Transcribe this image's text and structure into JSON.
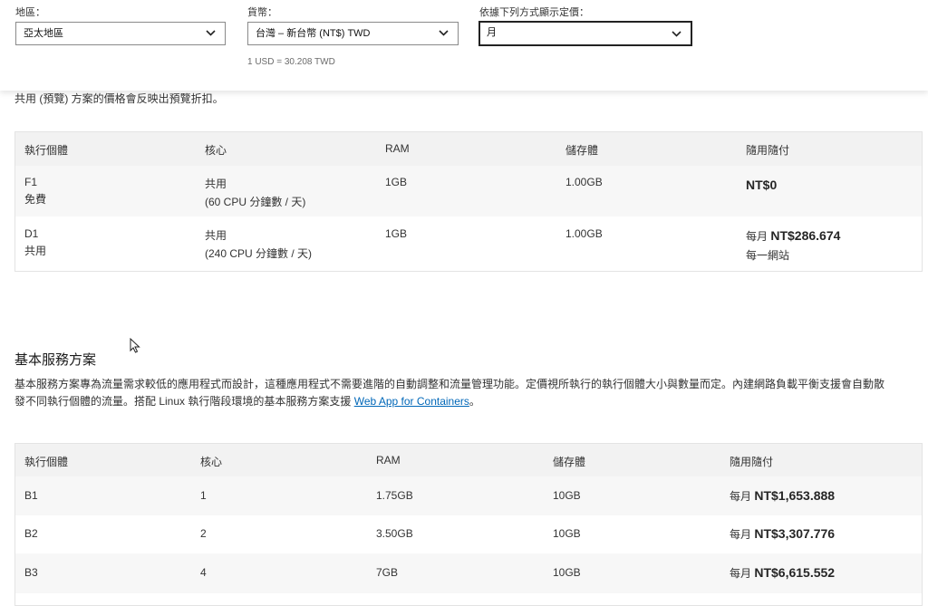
{
  "filters": {
    "region": {
      "label": "地區：",
      "value": "亞太地區"
    },
    "currency": {
      "label": "貨幣：",
      "value": "台灣 – 新台幣 (NT$) TWD"
    },
    "display": {
      "label": "依據下列方式顯示定價：",
      "value": "月"
    },
    "rate_note": "1 USD = 30.208 TWD"
  },
  "preview_note": "共用 (預覽) 方案的價格會反映出預覽折扣。",
  "free_shared_table": {
    "headers": [
      "執行個體",
      "核心",
      "RAM",
      "儲存體",
      "隨用隨付"
    ],
    "rows": [
      {
        "instance": "F1",
        "instance_sub": "免費",
        "cores": "共用",
        "cores_sub": "(60 CPU 分鐘數 / 天)",
        "ram": "1GB",
        "storage": "1.00GB",
        "price_prefix": "",
        "price": "NT$0",
        "price_sub": ""
      },
      {
        "instance": "D1",
        "instance_sub": "共用",
        "cores": "共用",
        "cores_sub": "(240 CPU 分鐘數 / 天)",
        "ram": "1GB",
        "storage": "1.00GB",
        "price_prefix": "每月",
        "price": "NT$286.674",
        "price_sub": "每一網站"
      }
    ]
  },
  "basic_section": {
    "title": "基本服務方案",
    "description_line1": "基本服務方案專為流量需求較低的應用程式而設計，這種應用程式不需要進階的自動調整和流量管理功能。定價視所執行的執行個體大小與數量而定。內建網路負載平衡支援會自動散",
    "description_line2_before": "發不同執行個體的流量。搭配 Linux 執行階段環境的基本服務方案支援 ",
    "link_text": "Web App for Containers",
    "description_line2_after": "。"
  },
  "basic_table": {
    "headers": [
      "執行個體",
      "核心",
      "RAM",
      "儲存體",
      "隨用隨付"
    ],
    "rows": [
      {
        "instance": "B1",
        "cores": "1",
        "ram": "1.75GB",
        "storage": "10GB",
        "price_prefix": "每月",
        "price": "NT$1,653.888"
      },
      {
        "instance": "B2",
        "cores": "2",
        "ram": "3.50GB",
        "storage": "10GB",
        "price_prefix": "每月",
        "price": "NT$3,307.776"
      },
      {
        "instance": "B3",
        "cores": "4",
        "ram": "7GB",
        "storage": "10GB",
        "price_prefix": "每月",
        "price": "NT$6,615.552"
      }
    ]
  },
  "icons": {
    "dropdown": "chevron-down-icon",
    "pointer": "mouse-cursor-icon"
  }
}
